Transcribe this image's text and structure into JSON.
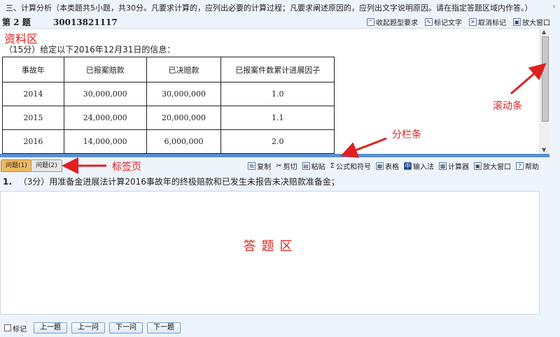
{
  "section_bar": {
    "text": "三、计算分析（本类题共5小题，共30分。凡要求计算的，应列出必要的计算过程；凡要求阐述原因的，应列出文字说明原因。请在指定答题区域内作答。）"
  },
  "question": {
    "title": "第 2 题",
    "id": "30013821117"
  },
  "top_tools": [
    "收起题型要求",
    "标记文字",
    "取消标记",
    "放大窗口"
  ],
  "material": {
    "label": "资料区",
    "intro": "（15分）给定以下2016年12月31日的信息：",
    "table": {
      "headers": [
        "事故年",
        "已报案赔款",
        "已决赔款",
        "已报案件数累计进展因子"
      ],
      "rows": [
        [
          "2014",
          "30,000,000",
          "30,000,000",
          "1.0"
        ],
        [
          "2015",
          "24,000,000",
          "20,000,000",
          "1.1"
        ],
        [
          "2016",
          "14,000,000",
          "6,000,000",
          "2.0"
        ]
      ]
    }
  },
  "tabs": [
    "问题(1)",
    "问题(2)"
  ],
  "bottom_tools": [
    "复制",
    "剪切",
    "粘贴",
    "公式和符号",
    "表格",
    "输入法",
    "计算器",
    "放大窗口",
    "帮助"
  ],
  "sub_question": {
    "number": "1.",
    "text": "（3分）用准备金进展法计算2016事故年的终极赔款和已发生未报告未决赔款准备金；"
  },
  "answer_area": {
    "label": "答题区"
  },
  "footer": {
    "mark_label": "标记",
    "buttons": [
      "上一题",
      "上一问",
      "下一问",
      "下一题"
    ]
  },
  "annotations": {
    "scrollbar": "滚动条",
    "splitter": "分栏条",
    "tabs": "标签页"
  },
  "colors": {
    "annotation": "#e02020",
    "splitter": "#5b8fd0",
    "active_tab": "#f0b960"
  }
}
